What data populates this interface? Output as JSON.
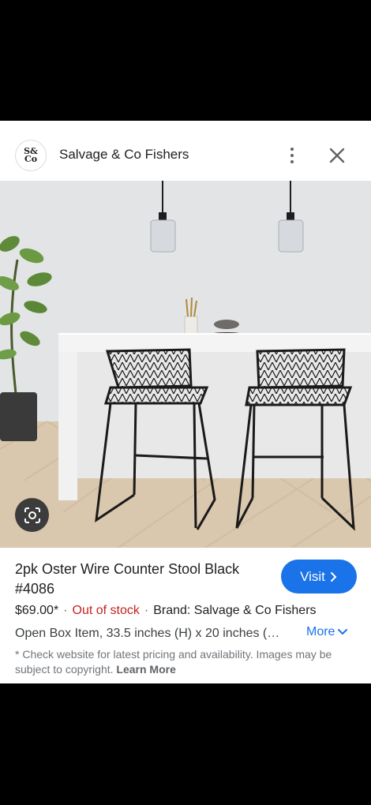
{
  "header": {
    "logo_text": "S&\nCo",
    "site_name": "Salvage & Co Fishers",
    "menu_icon": "more-vert-icon",
    "close_icon": "close-icon"
  },
  "image": {
    "lens_icon": "lens-search-icon"
  },
  "product": {
    "title": "2pk Oster Wire Counter Stool Black #4086",
    "visit_label": "Visit",
    "price": "$69.00*",
    "stock": "Out of stock",
    "brand": "Brand: Salvage & Co Fishers",
    "description": "Open Box Item, 33.5 inches (H) x 20 inches (…",
    "more_label": "More",
    "disclaimer": "* Check website for latest pricing and availability. Images may be subject to copyright.",
    "learn_more": "Learn More"
  },
  "colors": {
    "accent": "#1a73e8",
    "out_of_stock": "#c5221f"
  }
}
